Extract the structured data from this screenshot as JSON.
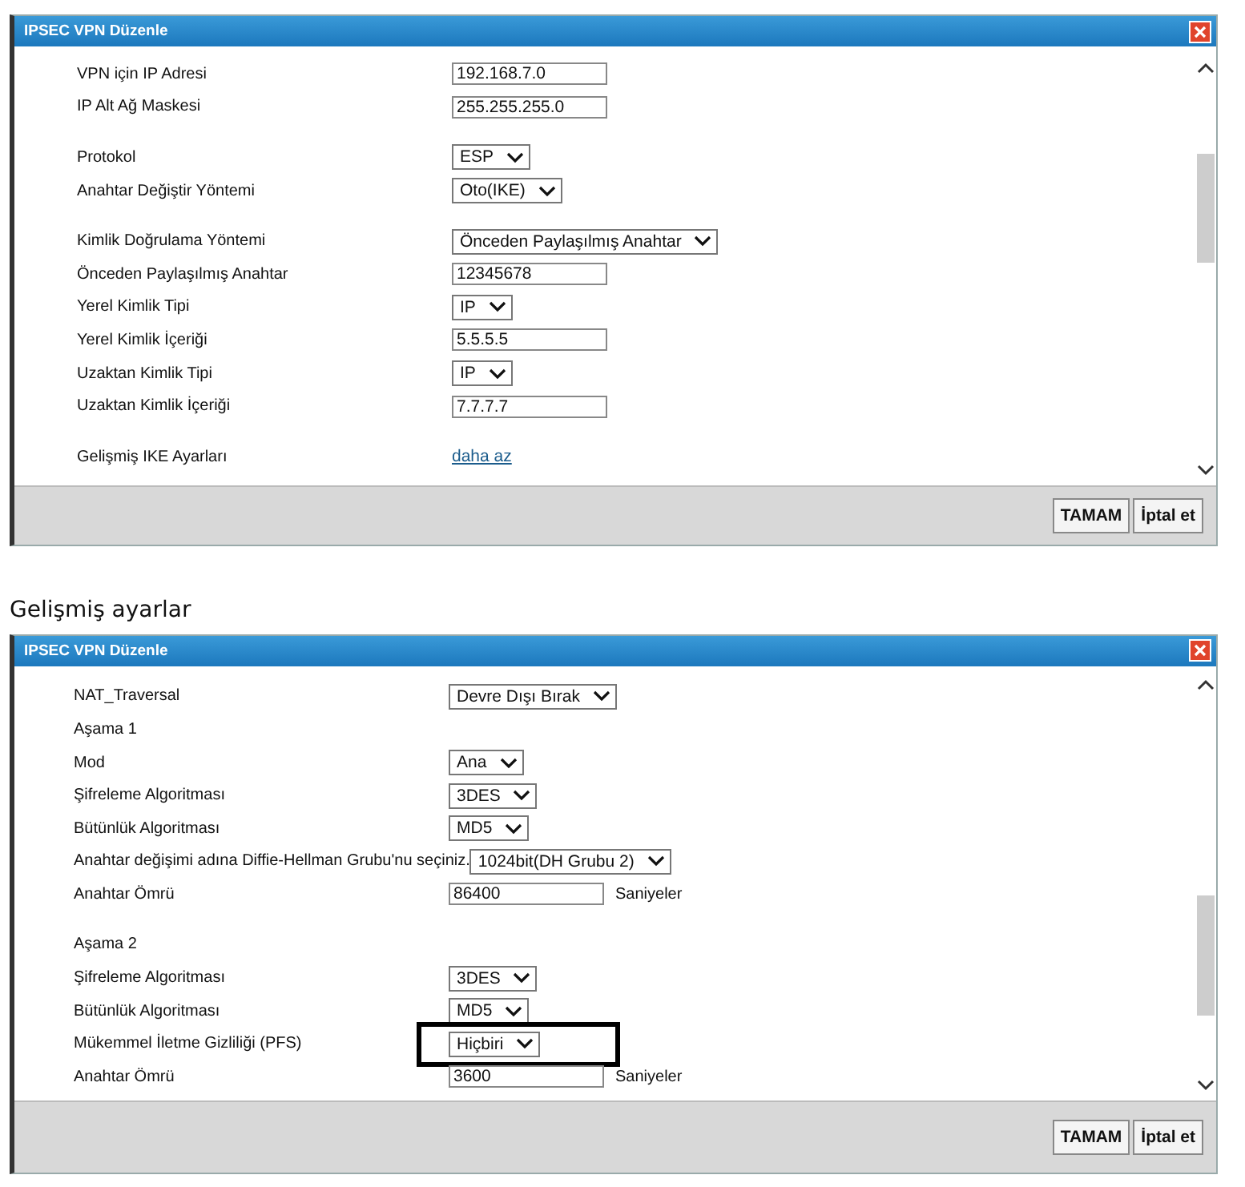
{
  "dialog": {
    "title": "IPSEC VPN Düzenle",
    "sections": [
      {
        "rows": [
          {
            "label": "VPN için IP Adresi",
            "kind": "text",
            "value": "192.168.7.0",
            "highlighted": false
          },
          {
            "label": "IP Alt Ağ Maskesi",
            "kind": "text",
            "value": "255.255.255.0",
            "highlighted": false
          }
        ]
      },
      {
        "rows": [
          {
            "label": "Protokol",
            "kind": "select",
            "value": "ESP",
            "highlighted": false
          },
          {
            "label": "Anahtar Değiştir Yöntemi",
            "kind": "select",
            "value": "Oto(IKE)",
            "highlighted": false
          }
        ]
      },
      {
        "rows": [
          {
            "label": "Kimlik Doğrulama Yöntemi",
            "kind": "select",
            "value": "Önceden Paylaşılmış Anahtar",
            "highlighted": false
          },
          {
            "label": "Önceden Paylaşılmış Anahtar",
            "kind": "text",
            "value": "12345678",
            "highlighted": false
          },
          {
            "label": "Yerel Kimlik Tipi",
            "kind": "select",
            "value": "IP",
            "highlighted": false
          },
          {
            "label": "Yerel Kimlik İçeriği",
            "kind": "text",
            "value": "5.5.5.5",
            "highlighted": false
          },
          {
            "label": "Uzaktan Kimlik Tipi",
            "kind": "select",
            "value": "IP",
            "highlighted": false
          },
          {
            "label": "Uzaktan Kimlik İçeriği",
            "kind": "text",
            "value": "7.7.7.7",
            "highlighted": false
          }
        ]
      },
      {
        "rows": [
          {
            "label": "Gelişmiş IKE Ayarları",
            "kind": "link",
            "value": "daha az",
            "highlighted": false
          }
        ]
      }
    ],
    "buttons": [
      "TAMAM",
      "İptal et"
    ]
  },
  "heading": "Gelişmiş ayarlar",
  "advanced_dialog": {
    "title": "IPSEC VPN Düzenle",
    "sections": [
      {
        "rows": [
          {
            "label": "NAT_Traversal",
            "kind": "select",
            "value": "Devre Dışı Bırak",
            "highlighted": false
          },
          {
            "label": "Aşama 1",
            "kind": "label",
            "highlighted": false
          },
          {
            "label": "Mod",
            "kind": "select",
            "value": "Ana",
            "highlighted": false
          },
          {
            "label": "Şifreleme Algoritması",
            "kind": "select",
            "value": "3DES",
            "highlighted": false
          },
          {
            "label": "Bütünlük Algoritması",
            "kind": "select",
            "value": "MD5",
            "highlighted": false
          },
          {
            "label": "Anahtar değişimi adına Diffie-Hellman Grubu'nu seçiniz.",
            "kind": "select",
            "value": "1024bit(DH Grubu 2)",
            "highlighted": false
          },
          {
            "label": "Anahtar Ömrü",
            "kind": "text",
            "value": "86400",
            "unit": "Saniyeler",
            "highlighted": false
          }
        ]
      },
      {
        "rows": [
          {
            "label": "Aşama 2",
            "kind": "label",
            "highlighted": false
          },
          {
            "label": "Şifreleme Algoritması",
            "kind": "select",
            "value": "3DES",
            "highlighted": false
          },
          {
            "label": "Bütünlük Algoritması",
            "kind": "select",
            "value": "MD5",
            "highlighted": false
          },
          {
            "label": "Mükemmel İletme Gizliliği (PFS)",
            "kind": "select",
            "value": "Hiçbiri",
            "highlighted": true
          },
          {
            "label": "Anahtar Ömrü",
            "kind": "text",
            "value": "3600",
            "unit": "Saniyeler",
            "highlighted": false
          }
        ]
      }
    ],
    "buttons": [
      "TAMAM",
      "İptal et"
    ]
  }
}
